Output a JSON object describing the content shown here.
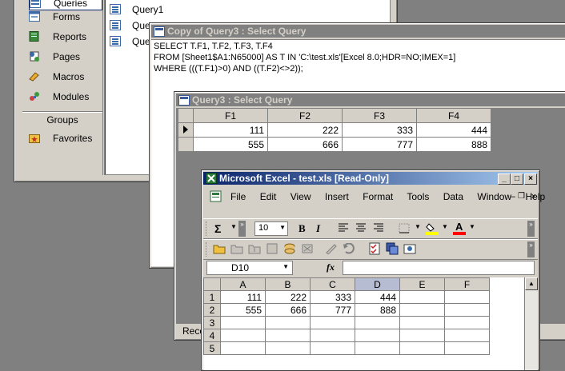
{
  "nav": {
    "items": [
      {
        "label": "Queries",
        "icon": "queries-icon"
      },
      {
        "label": "Forms",
        "icon": "forms-icon"
      },
      {
        "label": "Reports",
        "icon": "reports-icon"
      },
      {
        "label": "Pages",
        "icon": "pages-icon"
      },
      {
        "label": "Macros",
        "icon": "macros-icon"
      },
      {
        "label": "Modules",
        "icon": "modules-icon"
      }
    ],
    "groups_label": "Groups",
    "favorites_label": "Favorites"
  },
  "query_list": [
    "Query1",
    "Que",
    "Que"
  ],
  "copy_query": {
    "title": "Copy of Query3 : Select Query",
    "sql": [
      "SELECT T.F1, T.F2, T.F3, T.F4",
      "FROM [Sheet1$A1:N65000] AS T IN 'C:\\test.xls'[Excel 8.0;HDR=NO;IMEX=1]",
      "WHERE (((T.F1)>0) AND ((T.F2)<>2));"
    ]
  },
  "query3": {
    "title": "Query3 : Select Query",
    "columns": [
      "F1",
      "F2",
      "F3",
      "F4"
    ],
    "rows": [
      [
        "111",
        "222",
        "333",
        "444"
      ],
      [
        "555",
        "666",
        "777",
        "888"
      ]
    ],
    "status": "Reco"
  },
  "excel": {
    "title": "Microsoft Excel - test.xls  [Read-Only]",
    "menu": [
      "File",
      "Edit",
      "View",
      "Insert",
      "Format",
      "Tools",
      "Data",
      "Window",
      "Help"
    ],
    "sigma": "Σ",
    "font_size": "10",
    "bold": "B",
    "italic": "I",
    "font_color": "A",
    "name_box": "D10",
    "fx": "fx",
    "col_headers": [
      "A",
      "B",
      "C",
      "D",
      "E",
      "F"
    ],
    "row_headers": [
      "1",
      "2",
      "3",
      "4",
      "5"
    ],
    "cells": [
      [
        "111",
        "222",
        "333",
        "444",
        "",
        ""
      ],
      [
        "555",
        "666",
        "777",
        "888",
        "",
        ""
      ],
      [
        "",
        "",
        "",
        "",
        "",
        ""
      ],
      [
        "",
        "",
        "",
        "",
        "",
        ""
      ],
      [
        "",
        "",
        "",
        "",
        "",
        ""
      ]
    ],
    "selected_column": "D"
  }
}
